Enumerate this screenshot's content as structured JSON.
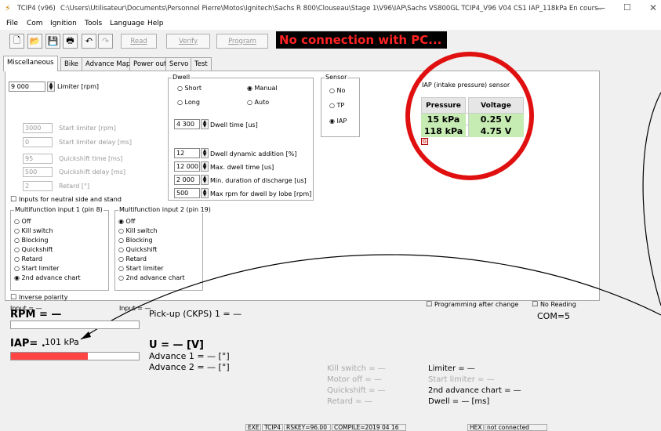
{
  "window": {
    "app": "TCIP4 (v96)",
    "path": "C:\\Users\\Utilisateur\\Documents\\Personnel Pierre\\Motos\\Ignitech\\Sachs R 800\\Clouseau\\Stage 1\\V96\\IAP\\Sachs VS800GL TCIP4_V96 V04 CS1 IAP_118kPa En cours....",
    "min": "—",
    "max": "☐",
    "close": "✕"
  },
  "menu": [
    "File",
    "Com",
    "Ignition",
    "Tools",
    "Language",
    "Help"
  ],
  "toolbar": {
    "read": "Read",
    "verify": "Verify",
    "program": "Program",
    "status": "No connection with PC..."
  },
  "tabs": [
    "Miscellaneous",
    "Bike",
    "Advance Map",
    "Power out",
    "Servo",
    "Test"
  ],
  "misc": {
    "limiter_val": "9 000",
    "limiter_lbl": "Limiter [rpm]",
    "start_limiter_val": "3000",
    "start_limiter_lbl": "Start limiter [rpm]",
    "start_delay_val": "0",
    "start_delay_lbl": "Start limiter delay [ms]",
    "qs_time_val": "95",
    "qs_time_lbl": "Quickshift time [ms]",
    "qs_delay_val": "500",
    "qs_delay_lbl": "Quickshift delay [ms]",
    "retard_val": "2",
    "retard_lbl": "Retard [°]",
    "neutral": "Inputs for neutral side and stand",
    "mf1_title": "Multifunction input 1 (pin 8)",
    "mf2_title": "Multifunction input 2 (pin 19)",
    "mf_opts": [
      "Off",
      "Kill switch",
      "Blocking",
      "Quickshift",
      "Retard",
      "Start limiter",
      "2nd advance chart"
    ],
    "inverse": "Inverse polarity",
    "input1": "Input = —",
    "input2": "Input = —"
  },
  "dwell": {
    "title": "Dwell",
    "short": "Short",
    "long": "Long",
    "manual": "Manual",
    "auto": "Auto",
    "time_val": "4 300",
    "time_lbl": "Dwell time [us]",
    "dyn_val": "12",
    "dyn_lbl": "Dwell dynamic addition [%]",
    "max_val": "12 000",
    "max_lbl": "Max. dwell time [us]",
    "min_val": "2 000",
    "min_lbl": "Min. duration of discharge [us]",
    "lobe_val": "500",
    "lobe_lbl": "Max rpm for dwell by lobe [rpm]"
  },
  "sensor": {
    "title": "Sensor",
    "opts": [
      "No",
      "TP",
      "IAP"
    ]
  },
  "iap": {
    "title": "IAP (intake pressure) sensor",
    "h1": "Pressure",
    "h2": "Voltage",
    "rows": [
      [
        "15 kPa",
        "0.25 V"
      ],
      [
        "118 kPa",
        "4.75 V"
      ]
    ],
    "g": "G"
  },
  "live": {
    "rpm": "RPM = —",
    "pickup": "Pick-up (CKPS) 1 = —",
    "iap": "IAP= .",
    "iap_val": "101 kPa",
    "iap_fill": 0.6,
    "u": "U = — [V]",
    "adv1": "Advance 1 = — [°]",
    "adv2": "Advance 2 = — [°]",
    "prog_after": "Programming after change",
    "no_reading": "No Reading",
    "com": "COM=5",
    "kill": "Kill switch = —",
    "motor": "Motor off = —",
    "qs": "Quickshift = —",
    "retard": "Retard = —",
    "limiter": "Limiter = —",
    "start_lim": "Start limiter = —",
    "adv2chart": "2nd advance chart = —",
    "dwell": "Dwell = — [ms]"
  },
  "statusbar": {
    "exe": "EXE",
    "tcip": "TCIP4",
    "rskey": "RSKEY=96.00",
    "compile": "COMPILE=2019 04 16",
    "hex": "HEX",
    "conn": "not connected"
  }
}
